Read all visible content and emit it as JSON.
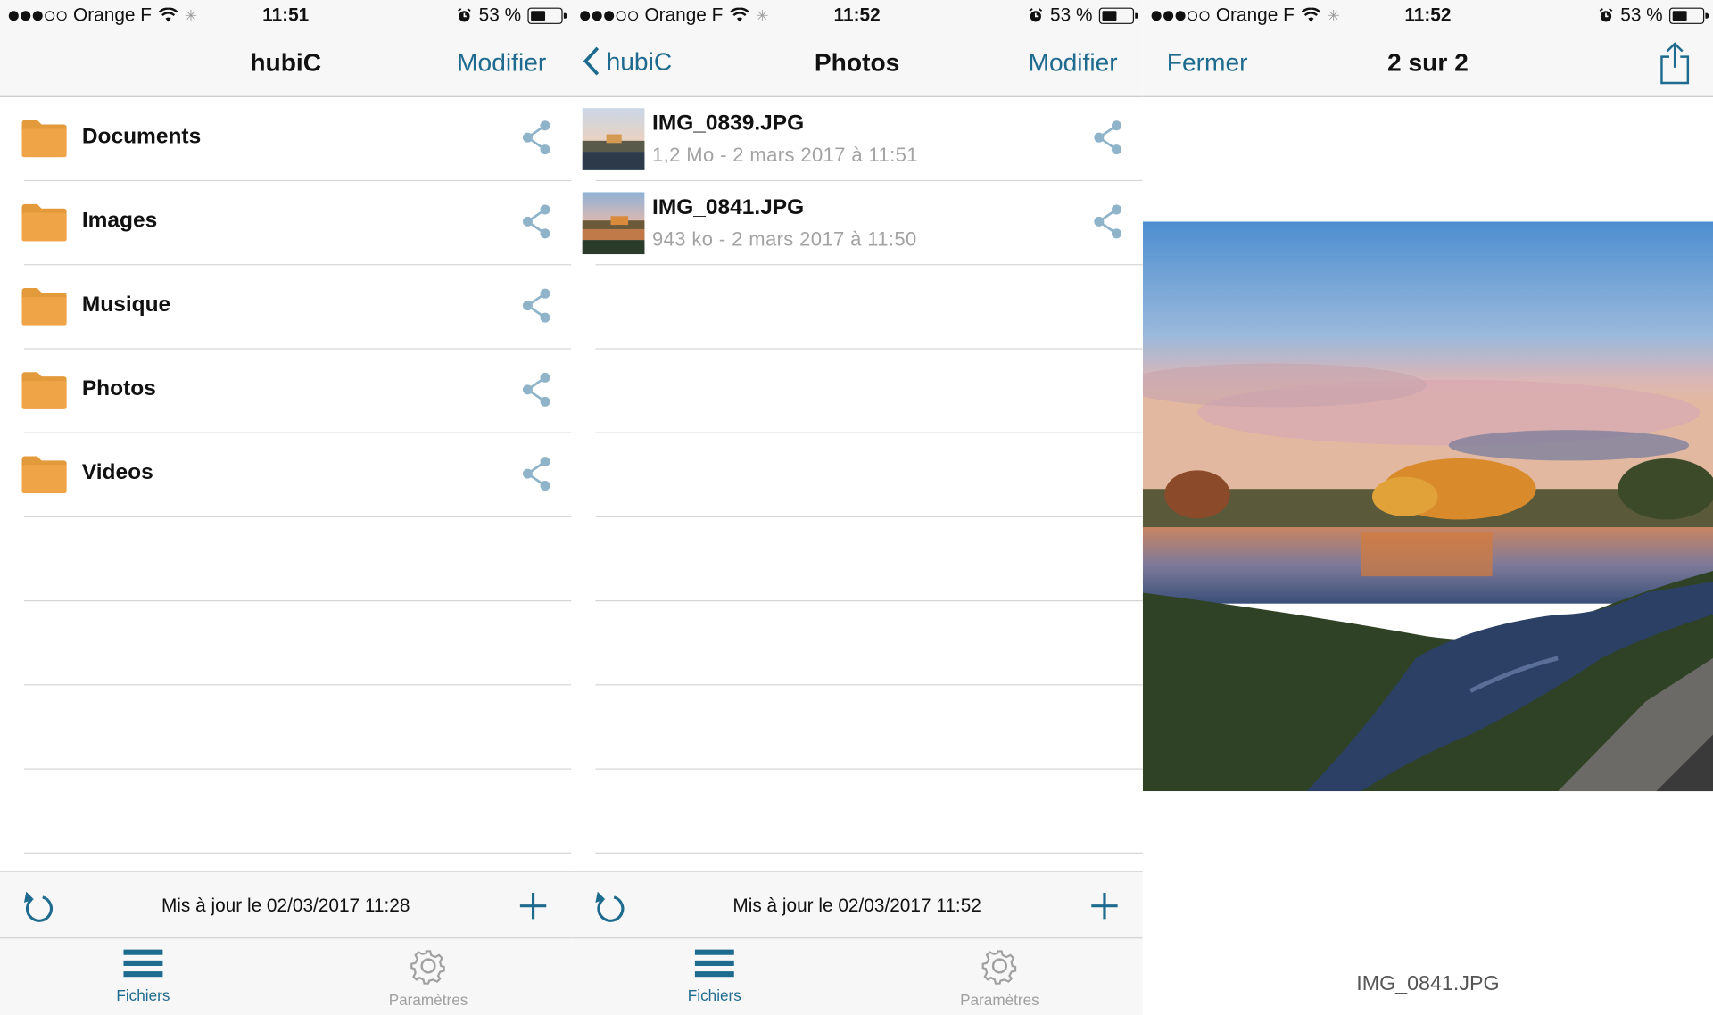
{
  "status_bars": [
    {
      "carrier": "Orange F",
      "time": "11:51",
      "battery": "53 %",
      "battery_level": 0.53
    },
    {
      "carrier": "Orange F",
      "time": "11:52",
      "battery": "53 %",
      "battery_level": 0.53
    },
    {
      "carrier": "Orange F",
      "time": "11:52",
      "battery": "53 %",
      "battery_level": 0.53
    }
  ],
  "root_screen": {
    "title": "hubiC",
    "edit_label": "Modifier",
    "folders": [
      {
        "name": "Documents"
      },
      {
        "name": "Images"
      },
      {
        "name": "Musique"
      },
      {
        "name": "Photos"
      },
      {
        "name": "Videos"
      }
    ],
    "updated": "Mis à jour le 02/03/2017 11:28"
  },
  "photos_screen": {
    "back_label": "hubiC",
    "title": "Photos",
    "edit_label": "Modifier",
    "files": [
      {
        "name": "IMG_0839.JPG",
        "meta": "1,2 Mo - 2 mars 2017 à 11:51"
      },
      {
        "name": "IMG_0841.JPG",
        "meta": "943 ko - 2 mars 2017 à 11:50"
      }
    ],
    "updated": "Mis à jour le 02/03/2017 11:52"
  },
  "viewer_screen": {
    "close_label": "Fermer",
    "counter": "2 sur 2",
    "caption": "IMG_0841.JPG"
  },
  "tabs": {
    "files_label": "Fichiers",
    "settings_label": "Paramètres"
  },
  "colors": {
    "accent": "#1e6b8f",
    "folder": "#e39a3b",
    "share_icon": "#8fb3c8",
    "meta_text": "#a3a3a3"
  },
  "icons": [
    "folder-icon",
    "share-icon",
    "refresh-icon",
    "add-icon",
    "list-icon",
    "gear-icon",
    "back-chevron-icon",
    "share-up-icon",
    "wifi-icon",
    "alarm-icon",
    "battery-icon"
  ]
}
